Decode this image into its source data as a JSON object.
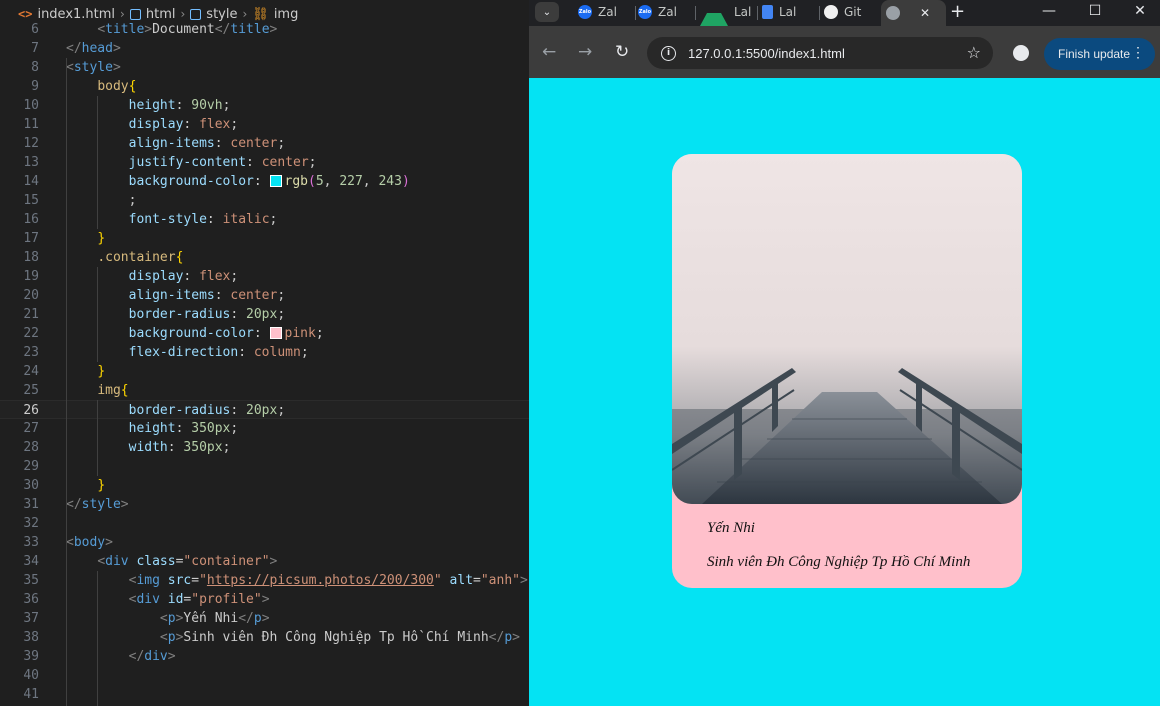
{
  "editor": {
    "breadcrumb": {
      "file_icon": "<>",
      "file": "index1.html",
      "items": [
        "html",
        "style",
        "img"
      ]
    },
    "lines": [
      {
        "n": "6",
        "html": "    <span class='t-tag'>&lt;</span><span class='t-name'>title</span><span class='t-tag'>&gt;</span><span class='t-txt'>Document</span><span class='t-tag'>&lt;/</span><span class='t-name'>title</span><span class='t-tag'>&gt;</span>"
      },
      {
        "n": "7",
        "html": "<span class='t-tag'>&lt;/</span><span class='t-name'>head</span><span class='t-tag'>&gt;</span>"
      },
      {
        "n": "8",
        "html": "<span class='t-tag'>&lt;</span><span class='t-name'>style</span><span class='t-tag'>&gt;</span>"
      },
      {
        "n": "9",
        "html": "    <span class='t-sel'>body</span><span class='t-br'>{</span>"
      },
      {
        "n": "10",
        "html": "        <span class='t-prop'>height</span><span class='t-txt'>: </span><span class='t-num'>90vh</span><span class='t-txt'>;</span>"
      },
      {
        "n": "11",
        "html": "        <span class='t-prop'>display</span><span class='t-txt'>: </span><span class='t-val'>flex</span><span class='t-txt'>;</span>"
      },
      {
        "n": "12",
        "html": "        <span class='t-prop'>align-items</span><span class='t-txt'>: </span><span class='t-val'>center</span><span class='t-txt'>;</span>"
      },
      {
        "n": "13",
        "html": "        <span class='t-prop'>justify-content</span><span class='t-txt'>: </span><span class='t-val'>center</span><span class='t-txt'>;</span>"
      },
      {
        "n": "14",
        "html": "        <span class='t-prop'>background-color</span><span class='t-txt'>: </span><span class='swatch' style='background:#05e3f3'></span><span class='t-fn'>rgb</span><span class='t-pn'>(</span><span class='t-num'>5</span><span class='t-txt'>, </span><span class='t-num'>227</span><span class='t-txt'>, </span><span class='t-num'>243</span><span class='t-pn'>)</span>"
      },
      {
        "n": "15",
        "html": "        <span class='t-txt'>;</span>"
      },
      {
        "n": "16",
        "html": "        <span class='t-prop'>font-style</span><span class='t-txt'>: </span><span class='t-val'>italic</span><span class='t-txt'>;</span>"
      },
      {
        "n": "17",
        "html": "    <span class='t-br'>}</span>"
      },
      {
        "n": "18",
        "html": "    <span class='t-sel'>.container</span><span class='t-br'>{</span>"
      },
      {
        "n": "19",
        "html": "        <span class='t-prop'>display</span><span class='t-txt'>: </span><span class='t-val'>flex</span><span class='t-txt'>;</span>"
      },
      {
        "n": "20",
        "html": "        <span class='t-prop'>align-items</span><span class='t-txt'>: </span><span class='t-val'>center</span><span class='t-txt'>;</span>"
      },
      {
        "n": "21",
        "html": "        <span class='t-prop'>border-radius</span><span class='t-txt'>: </span><span class='t-num'>20px</span><span class='t-txt'>;</span>"
      },
      {
        "n": "22",
        "html": "        <span class='t-prop'>background-color</span><span class='t-txt'>: </span><span class='swatch' style='background:#ffc0cb'></span><span class='t-val'>pink</span><span class='t-txt'>;</span>"
      },
      {
        "n": "23",
        "html": "        <span class='t-prop'>flex-direction</span><span class='t-txt'>: </span><span class='t-val'>column</span><span class='t-txt'>;</span>"
      },
      {
        "n": "24",
        "html": "    <span class='t-br'>}</span>"
      },
      {
        "n": "25",
        "html": "    <span class='t-sel'>img</span><span class='t-br'>{</span>"
      },
      {
        "n": "26",
        "html": "        <span class='t-prop'>border-radius</span><span class='t-txt'>: </span><span class='t-num'>20px</span><span class='t-txt'>;</span>",
        "active": true
      },
      {
        "n": "27",
        "html": "        <span class='t-prop'>height</span><span class='t-txt'>: </span><span class='t-num'>350px</span><span class='t-txt'>;</span>"
      },
      {
        "n": "28",
        "html": "        <span class='t-prop'>width</span><span class='t-txt'>: </span><span class='t-num'>350px</span><span class='t-txt'>;</span>"
      },
      {
        "n": "29",
        "html": ""
      },
      {
        "n": "30",
        "html": "    <span class='t-br'>}</span>"
      },
      {
        "n": "31",
        "html": "<span class='t-tag'>&lt;/</span><span class='t-name'>style</span><span class='t-tag'>&gt;</span>"
      },
      {
        "n": "32",
        "html": ""
      },
      {
        "n": "33",
        "html": "<span class='t-tag'>&lt;</span><span class='t-name'>body</span><span class='t-tag'>&gt;</span>"
      },
      {
        "n": "34",
        "html": "    <span class='t-tag'>&lt;</span><span class='t-name'>div</span> <span class='t-attr'>class</span><span class='t-txt'>=</span><span class='t-str'>\"container\"</span><span class='t-tag'>&gt;</span>"
      },
      {
        "n": "35",
        "html": "        <span class='t-tag'>&lt;</span><span class='t-name'>img</span> <span class='t-attr'>src</span><span class='t-txt'>=</span><span class='t-str'>\"</span><span class='t-link'>https://picsum.photos/200/300</span><span class='t-str'>\"</span> <span class='t-attr'>alt</span><span class='t-txt'>=</span><span class='t-str'>\"anh\"</span><span class='t-tag'>&gt;</span>"
      },
      {
        "n": "36",
        "html": "        <span class='t-tag'>&lt;</span><span class='t-name'>div</span> <span class='t-attr'>id</span><span class='t-txt'>=</span><span class='t-str'>\"profile\"</span><span class='t-tag'>&gt;</span>"
      },
      {
        "n": "37",
        "html": "            <span class='t-tag'>&lt;</span><span class='t-name'>p</span><span class='t-tag'>&gt;</span><span class='t-txt'>Yến Nhi</span><span class='t-tag'>&lt;/</span><span class='t-name'>p</span><span class='t-tag'>&gt;</span>"
      },
      {
        "n": "38",
        "html": "            <span class='t-tag'>&lt;</span><span class='t-name'>p</span><span class='t-tag'>&gt;</span><span class='t-txt'>Sinh viên Đh Công Nghiệp Tp Hồ Chí Minh</span><span class='t-tag'>&lt;/</span><span class='t-name'>p</span><span class='t-tag'>&gt;</span>"
      },
      {
        "n": "39",
        "html": "        <span class='t-tag'>&lt;/</span><span class='t-name'>div</span><span class='t-tag'>&gt;</span>"
      },
      {
        "n": "40",
        "html": ""
      },
      {
        "n": "41",
        "html": ""
      }
    ]
  },
  "browser": {
    "tabs": [
      {
        "label": "Zal",
        "icon": "zalo-icon",
        "fav": "Zalo",
        "cls": "fav-zalo"
      },
      {
        "label": "Zal",
        "icon": "zalo-icon",
        "fav": "Zalo",
        "cls": "fav-zalo"
      },
      {
        "label": "Lal",
        "icon": "google-drive-icon",
        "fav": "",
        "cls": "fav-drive"
      },
      {
        "label": "Lal",
        "icon": "google-docs-icon",
        "fav": "",
        "cls": "fav-docs"
      },
      {
        "label": "Git",
        "icon": "github-icon",
        "fav": "",
        "cls": "fav-git"
      },
      {
        "label": "",
        "icon": "globe-icon",
        "fav": "",
        "cls": "fav-globe",
        "active": true
      }
    ],
    "close_glyph": "✕",
    "new_tab_glyph": "+",
    "tab_search_glyph": "⌄",
    "window": {
      "minimize": "—",
      "maximize": "☐",
      "close": "✕"
    },
    "nav": {
      "back": "←",
      "forward": "→",
      "reload": "↻"
    },
    "url": "127.0.0.1:5500/index1.html",
    "info_glyph": "i",
    "star_glyph": "☆",
    "update_label": "Finish update",
    "update_menu_glyph": "⋮",
    "page_bg": "#04e3f3"
  },
  "page": {
    "name": "Yến Nhi",
    "description": "Sinh viên Đh Công Nghiệp Tp Hồ Chí Minh",
    "image_alt": "anh",
    "card_color": "#ffc0cb"
  }
}
